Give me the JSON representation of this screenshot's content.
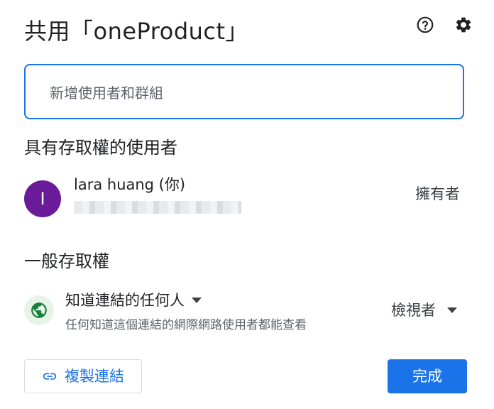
{
  "dialog": {
    "title": "共用「oneProduct」",
    "help_icon": "help-icon",
    "settings_icon": "gear-icon"
  },
  "add_people": {
    "placeholder": "新增使用者和群組",
    "value": ""
  },
  "people_section": {
    "heading": "具有存取權的使用者",
    "users": [
      {
        "avatar_letter": "I",
        "avatar_color": "#6a1b9a",
        "name": "lara huang (你)",
        "role": "擁有者"
      }
    ]
  },
  "general_access": {
    "heading": "一般存取權",
    "icon": "globe-icon",
    "icon_bg": "#e6f4ea",
    "icon_color": "#188038",
    "link_setting": "知道連結的任何人",
    "description": "任何知道這個連結的網際網路使用者都能查看",
    "role": "檢視者"
  },
  "footer": {
    "copy_link_label": "複製連結",
    "done_label": "完成"
  },
  "colors": {
    "accent": "#1a73e8",
    "text": "#202124",
    "secondary_text": "#5f6368"
  }
}
